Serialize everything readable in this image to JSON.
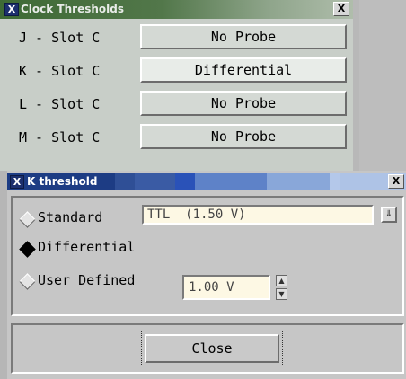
{
  "clock_window": {
    "title": "Clock Thresholds",
    "close_glyph": "X",
    "rows": [
      {
        "label": "J - Slot C",
        "value": "No Probe",
        "active": false
      },
      {
        "label": "K - Slot C",
        "value": "Differential",
        "active": true
      },
      {
        "label": "L - Slot C",
        "value": "No Probe",
        "active": false
      },
      {
        "label": "M - Slot C",
        "value": "No Probe",
        "active": false
      }
    ]
  },
  "threshold_window": {
    "title": "K threshold",
    "close_glyph": "X",
    "standard": {
      "label": "Standard",
      "value": "TTL  (1.50 V)",
      "selected": false
    },
    "differential": {
      "label": "Differential",
      "selected": true
    },
    "user_defined": {
      "label": "User Defined",
      "value": "1.00 V",
      "selected": false
    },
    "close_label": "Close"
  },
  "colors": {
    "clock_titlebar": "#3e6a35",
    "threshold_titlebar": "#1d3c84",
    "field_background": "#fdf8e4"
  },
  "icons": {
    "app_badge": "X",
    "spin_up": "▲",
    "spin_down": "▼",
    "dropdown": "⇓"
  }
}
